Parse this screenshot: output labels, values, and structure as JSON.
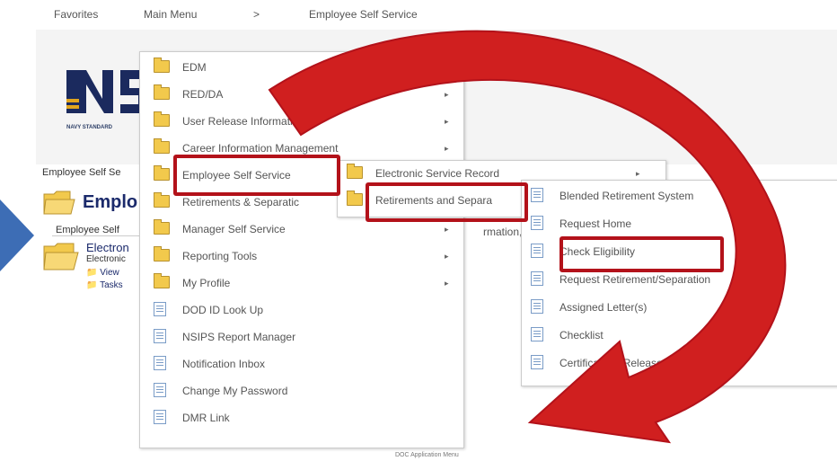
{
  "nav": {
    "favorites": "Favorites",
    "main_menu": "Main Menu",
    "sep": ">",
    "current": "Employee Self Service"
  },
  "logo": {
    "text": "NAVY STANDARD"
  },
  "page": {
    "breadcrumb": "Employee Self Se",
    "title": "Emplo",
    "subtitle": "Employee Self",
    "electronic": "Electron",
    "electronic2": "Electronic",
    "view": "View",
    "tasks": "Tasks",
    "footer": "DOC Application Menu"
  },
  "menu1": [
    {
      "label": "EDM",
      "icon": "folder-icon",
      "sub": false
    },
    {
      "label": "RED/DA",
      "icon": "folder-icon",
      "sub": true
    },
    {
      "label": "User Release Information",
      "icon": "folder-icon",
      "sub": true
    },
    {
      "label": "Career Information Management",
      "icon": "folder-icon",
      "sub": true
    },
    {
      "label": "Employee Self Service",
      "icon": "folder-icon",
      "sub": false
    },
    {
      "label": "Retirements & Separatic",
      "icon": "folder-icon",
      "sub": false
    },
    {
      "label": "Manager Self Service",
      "icon": "folder-icon",
      "sub": true
    },
    {
      "label": "Reporting Tools",
      "icon": "folder-icon",
      "sub": true
    },
    {
      "label": "My Profile",
      "icon": "folder-icon",
      "sub": true
    },
    {
      "label": "DOD ID Look Up",
      "icon": "document-icon",
      "sub": false
    },
    {
      "label": "NSIPS Report Manager",
      "icon": "document-icon",
      "sub": false
    },
    {
      "label": "Notification Inbox",
      "icon": "document-icon",
      "sub": false
    },
    {
      "label": "Change My Password",
      "icon": "document-icon",
      "sub": false
    },
    {
      "label": "DMR Link",
      "icon": "document-icon",
      "sub": false
    }
  ],
  "menu2": [
    {
      "label": "Electronic Service Record",
      "icon": "folder-icon"
    },
    {
      "label": "Retirements and Separa",
      "icon": "folder-icon"
    },
    {
      "label": "rmation, Pay",
      "icon": ""
    }
  ],
  "menu3": [
    {
      "label": "Blended Retirement System"
    },
    {
      "label": "Request Home"
    },
    {
      "label": "Check Eligibility"
    },
    {
      "label": "Request Retirement/Separation"
    },
    {
      "label": "Assigned Letter(s)"
    },
    {
      "label": "Checklist"
    },
    {
      "label": "Certificate of Release"
    }
  ],
  "colors": {
    "highlight": "#b3121a",
    "arrow": "#d01f1f",
    "left_arrow": "#3d6db5"
  }
}
